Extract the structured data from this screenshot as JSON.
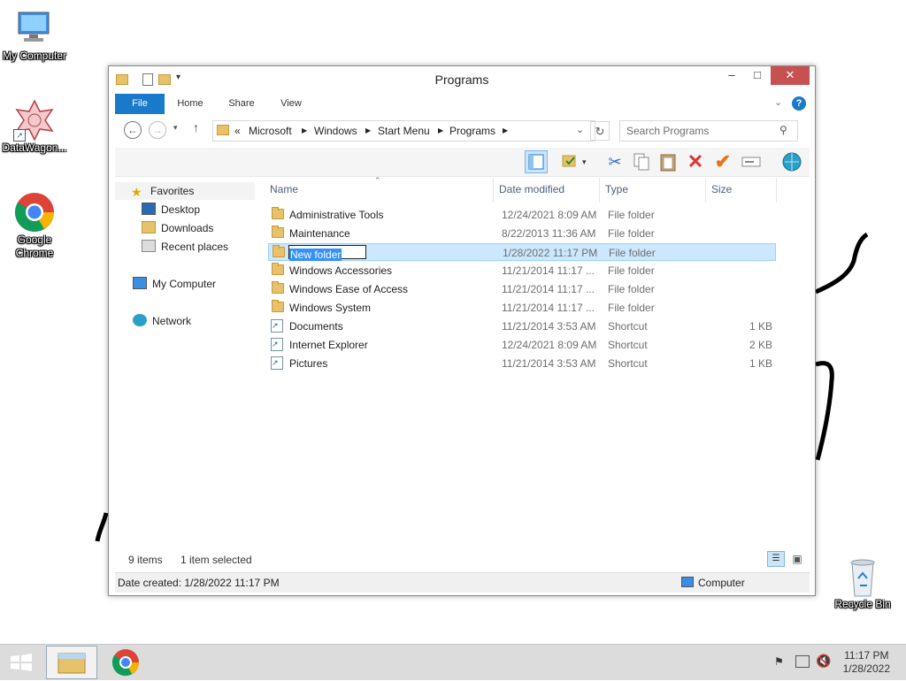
{
  "desktop": {
    "icons": [
      {
        "label": "My Computer"
      },
      {
        "label": "DataWagon..."
      },
      {
        "label": "Google Chrome"
      },
      {
        "label": "Recycle Bin"
      }
    ]
  },
  "window": {
    "title": "Programs",
    "ribbon_tabs": [
      "File",
      "Home",
      "Share",
      "View"
    ],
    "breadcrumb": [
      "Microsoft",
      "Windows",
      "Start Menu",
      "Programs"
    ],
    "breadcrumb_prefix": "«",
    "search_placeholder": "Search Programs",
    "nav": {
      "favorites": "Favorites",
      "desktop": "Desktop",
      "downloads": "Downloads",
      "recent": "Recent places",
      "my_computer": "My Computer",
      "network": "Network"
    },
    "columns": {
      "name": "Name",
      "date": "Date modified",
      "type": "Type",
      "size": "Size"
    },
    "files": [
      {
        "name": "Administrative Tools",
        "date": "12/24/2021 8:09 AM",
        "type": "File folder",
        "size": "",
        "kind": "folder"
      },
      {
        "name": "Maintenance",
        "date": "8/22/2013 11:36 AM",
        "type": "File folder",
        "size": "",
        "kind": "folder"
      },
      {
        "name": "New folder",
        "date": "1/28/2022 11:17 PM",
        "type": "File folder",
        "size": "",
        "kind": "folder",
        "selected": true,
        "renaming": true
      },
      {
        "name": "Windows Accessories",
        "date": "11/21/2014 11:17 ...",
        "type": "File folder",
        "size": "",
        "kind": "folder"
      },
      {
        "name": "Windows Ease of Access",
        "date": "11/21/2014 11:17 ...",
        "type": "File folder",
        "size": "",
        "kind": "folder"
      },
      {
        "name": "Windows System",
        "date": "11/21/2014 11:17 ...",
        "type": "File folder",
        "size": "",
        "kind": "folder"
      },
      {
        "name": "Documents",
        "date": "11/21/2014 3:53 AM",
        "type": "Shortcut",
        "size": "1 KB",
        "kind": "shortcut"
      },
      {
        "name": "Internet Explorer",
        "date": "12/24/2021 8:09 AM",
        "type": "Shortcut",
        "size": "2 KB",
        "kind": "shortcut"
      },
      {
        "name": "Pictures",
        "date": "11/21/2014 3:53 AM",
        "type": "Shortcut",
        "size": "1 KB",
        "kind": "shortcut"
      }
    ],
    "status": {
      "item_count": "9 items",
      "selection": "1 item selected",
      "date_created": "Date created: 1/28/2022 11:17 PM",
      "location": "Computer"
    }
  },
  "taskbar": {
    "time": "11:17 PM",
    "date": "1/28/2022"
  },
  "colors": {
    "accent": "#1979ca",
    "selection_bg": "#cce8ff",
    "close_button": "#c75050",
    "taskbar_bg": "#dcdcdc"
  }
}
